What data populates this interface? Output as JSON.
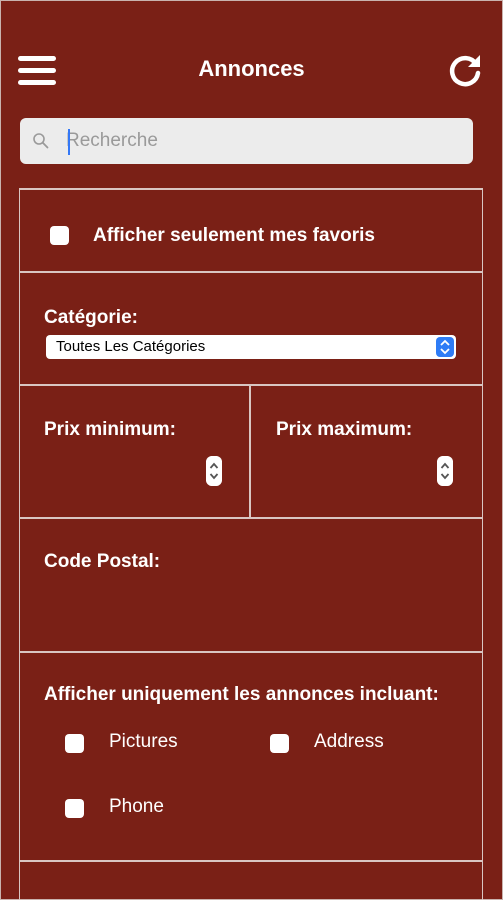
{
  "header": {
    "title": "Annonces",
    "menu_icon": "hamburger-menu-icon",
    "refresh_icon": "refresh-icon"
  },
  "search": {
    "placeholder": "Recherche",
    "value": "",
    "icon": "search-icon"
  },
  "favorites": {
    "label": "Afficher seulement mes favoris",
    "checked": false
  },
  "category": {
    "label": "Catégorie:",
    "selected": "Toutes Les Catégories"
  },
  "price": {
    "min_label": "Prix minimum:",
    "max_label": "Prix maximum:"
  },
  "postal": {
    "label": "Code Postal:"
  },
  "include": {
    "label": "Afficher uniquement les annonces incluant:",
    "options": [
      {
        "label": "Pictures",
        "checked": false
      },
      {
        "label": "Address",
        "checked": false
      },
      {
        "label": "Phone",
        "checked": false
      }
    ]
  },
  "colors": {
    "background": "#7a2016",
    "accent": "#2e7cf6",
    "search_bg": "#ececec"
  }
}
